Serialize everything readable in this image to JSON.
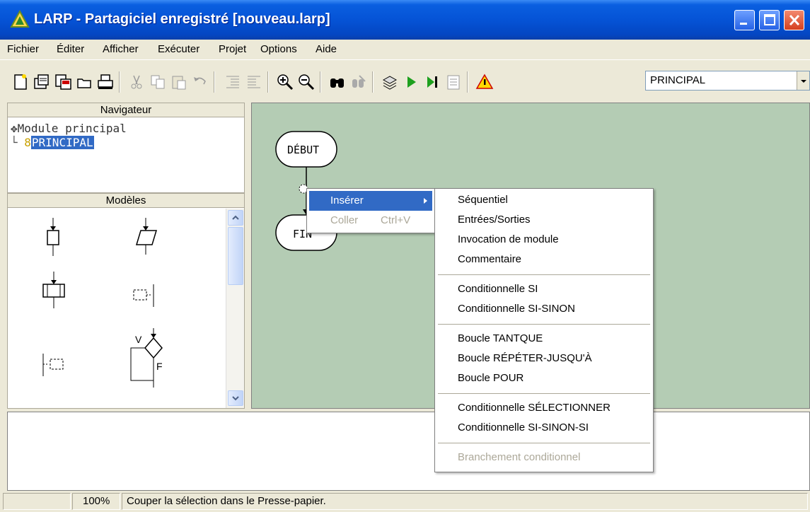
{
  "window": {
    "title": "LARP - Partagiciel enregistré [nouveau.larp]",
    "controls": [
      "minimize-icon",
      "maximize-icon",
      "close-icon"
    ]
  },
  "menubar": [
    "Fichier",
    "Éditer",
    "Afficher",
    "Exécuter",
    "Projet",
    "Options",
    "Aide"
  ],
  "toolbar": {
    "icons": [
      "new-file-icon",
      "open-file-icon",
      "save-file-icon",
      "folder-icon",
      "print-icon",
      "cut-icon",
      "copy-icon",
      "paste-icon",
      "undo-icon",
      "indent-icon",
      "outdent-icon",
      "zoom-in-icon",
      "zoom-out-icon",
      "find-icon",
      "replace-icon",
      "compile-icon",
      "run-icon",
      "step-icon",
      "console-icon",
      "warning-icon"
    ],
    "module_selector": "PRINCIPAL"
  },
  "navigator": {
    "title": "Navigateur",
    "root": "Module principal",
    "child": "PRINCIPAL"
  },
  "models": {
    "title": "Modèles",
    "items": [
      "sequential-block-icon",
      "io-block-icon",
      "module-call-icon",
      "comment-right-icon",
      "comment-left-icon",
      "conditional-icon"
    ],
    "labels": {
      "true": "V",
      "false": "F"
    }
  },
  "flowchart": {
    "start": "DÉBUT",
    "end": "FIN"
  },
  "context_menu": {
    "items": [
      {
        "label": "Insérer",
        "shortcut": "",
        "enabled": true,
        "highlighted": true
      },
      {
        "label": "Coller",
        "shortcut": "Ctrl+V",
        "enabled": false,
        "highlighted": false
      }
    ]
  },
  "submenu": {
    "groups": [
      [
        "Séquentiel",
        "Entrées/Sorties",
        "Invocation de module",
        "Commentaire"
      ],
      [
        "Conditionnelle SI",
        "Conditionnelle SI-SINON"
      ],
      [
        "Boucle TANTQUE",
        "Boucle RÉPÉTER-JUSQU'À",
        "Boucle POUR"
      ],
      [
        "Conditionnelle SÉLECTIONNER",
        "Conditionnelle SI-SINON-SI"
      ],
      [
        "Branchement conditionnel"
      ]
    ],
    "disabled": [
      "Branchement conditionnel"
    ]
  },
  "statusbar": {
    "zoom": "100%",
    "message": "Couper la sélection dans le Presse-papier."
  }
}
